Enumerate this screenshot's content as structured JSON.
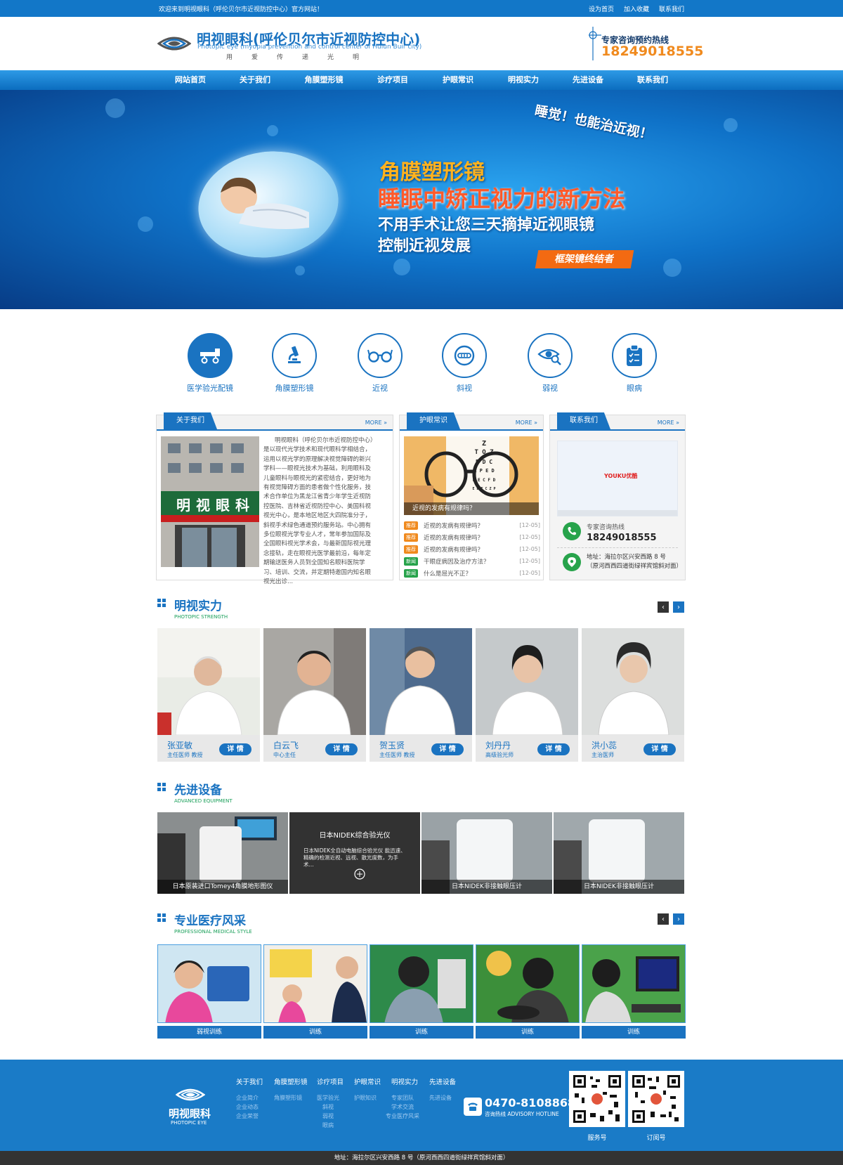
{
  "topbar": {
    "welcome": "欢迎来到明视眼科（呼伦贝尔市近视防控中心）官方网站！",
    "links": [
      "设为首页",
      "加入收藏",
      "联系我们"
    ]
  },
  "header": {
    "logo_title": "明视眼科(呼伦贝尔市近视防控中心)",
    "logo_en": "Photopic eye (myopia prevention and control center of Hulun Buir city)",
    "slogan": "用爱传递光明",
    "hotline_label": "专家咨询预约热线",
    "hotline_number": "18249018555"
  },
  "nav": [
    "网站首页",
    "关于我们",
    "角膜塑形镜",
    "诊疗项目",
    "护眼常识",
    "明视实力",
    "先进设备",
    "联系我们"
  ],
  "banner": {
    "tagline": "睡觉！也能治近视！",
    "h1": "角膜塑形镜",
    "h2": "睡眠中矫正视力的新方法",
    "h3": "不用手术让您三天摘掉近视眼镜",
    "h4": "控制近视发展",
    "tag": "框架镜终结者"
  },
  "services": [
    {
      "label": "医学验光配镜",
      "icon": "glasses-fitting-icon"
    },
    {
      "label": "角膜塑形镜",
      "icon": "microscope-icon"
    },
    {
      "label": "近视",
      "icon": "eyeglasses-icon"
    },
    {
      "label": "斜视",
      "icon": "strabismus-icon"
    },
    {
      "label": "弱视",
      "icon": "eye-search-icon"
    },
    {
      "label": "眼病",
      "icon": "clipboard-icon"
    }
  ],
  "about": {
    "tab": "关于我们",
    "more": "MORE",
    "sign_text": "明视眼科",
    "text": "明视眼科（呼伦贝尔市近视防控中心）是以现代光学技术和现代眼科学相结合，运用以视光学的原理解决视觉障碍的新兴学科——眼视光技术为基础，利用眼科及儿童眼科与眼视光的紧密结合，更好地为有视觉障碍方面的患者做个性化服务，技术合作单位为黑龙江省青少年学生近视防控医院、吉林省近视防控中心、美国科视视光中心，是本地区地区大四院准分子，斜视手术绿色通道预约服务站。中心拥有多位眼视光学专业人才，常年参加国际及全国眼科视光学术会，与最新国际视光理念接轨，走在眼视光医学最前沿，每年定期输送医务人员到全国知名眼科医院学习、培训、交流，并定期特邀国内知名眼视光出诊..."
  },
  "news": {
    "tab": "护眼常识",
    "more": "MORE",
    "caption": "近视的发病有规律吗？",
    "chart_lines": [
      "Z",
      "T O Z",
      "P D C",
      "L P E D",
      "P E C F D",
      "E D F C Z P"
    ],
    "items": [
      {
        "badge": "推荐",
        "color": "#f08a1e",
        "title": "近视的发病有规律吗？",
        "date": "[12-05]"
      },
      {
        "badge": "推荐",
        "color": "#f08a1e",
        "title": "近视的发病有规律吗？",
        "date": "[12-05]"
      },
      {
        "badge": "推荐",
        "color": "#f08a1e",
        "title": "近视的发病有规律吗？",
        "date": "[12-05]"
      },
      {
        "badge": "新闻",
        "color": "#27a34b",
        "title": "干眼症病因及治疗方法？",
        "date": "[12-05]"
      },
      {
        "badge": "新闻",
        "color": "#27a34b",
        "title": "什么是屈光不正？",
        "date": "[12-05]"
      }
    ]
  },
  "contact": {
    "tab": "联系我们",
    "more": "MORE",
    "video_brand": "YOUKU优酷",
    "hotline_label": "专家咨询热线",
    "hotline": "18249018555",
    "address_label": "地址：海拉尔区兴安西路 8 号",
    "address_note": "（原河西西四道街绿祥宾馆斜对面）"
  },
  "strength": {
    "title": "明视实力",
    "subtitle": "PHOTOPIC STRENGTH",
    "detail_label": "详 情",
    "doctors": [
      {
        "name": "张亚敏",
        "title": "主任医师 教授"
      },
      {
        "name": "白云飞",
        "title": "中心主任"
      },
      {
        "name": "贺玉贤",
        "title": "主任医师 教授"
      },
      {
        "name": "刘丹丹",
        "title": "高级验光师"
      },
      {
        "name": "洪小蕊",
        "title": "主治医师"
      }
    ]
  },
  "equipment": {
    "title": "先进设备",
    "subtitle": "ADVANCED EQUIPMENT",
    "overlay_title": "日本NIDEK综合验光仪",
    "overlay_text": "日本NIDEK全自动电脑综合验光仪 能迅速、精确的检测近视、远视、散光度数，为手术...",
    "items": [
      "日本原装进口Tomey4角膜地形图仪",
      "日本NIDEK综合验光仪",
      "日本NIDEK非接触眼压计",
      "日本NIDEK非接触眼压计"
    ]
  },
  "style": {
    "title": "专业医疗风采",
    "subtitle": "PROFESSIONAL MEDICAL STYLE",
    "items": [
      "弱视训练",
      "训练",
      "训练",
      "训练",
      "训练"
    ]
  },
  "footer": {
    "logo_cn": "明视眼科",
    "logo_en": "PHOTOPIC EYE",
    "cols": [
      {
        "h": "关于我们",
        "s": [
          "企业简介",
          "企业动态",
          "企业荣誉"
        ]
      },
      {
        "h": "角膜塑形镜",
        "s": [
          "角膜塑形镜"
        ]
      },
      {
        "h": "诊疗项目",
        "s": [
          "医学验光",
          "斜视",
          "弱视",
          "眼病"
        ]
      },
      {
        "h": "护眼常识",
        "s": [
          "护眼知识"
        ]
      },
      {
        "h": "明视实力",
        "s": [
          "专家团队",
          "学术交流",
          "专业医疗风采"
        ]
      },
      {
        "h": "先进设备",
        "s": [
          "先进设备"
        ]
      }
    ],
    "phone": "0470-8108868",
    "phone_label": "咨询热线 ADVISORY HOTLINE",
    "qr1": "服务号",
    "qr2": "订阅号"
  },
  "bottom": "地址：海拉尔区兴安西路 8 号（原河西西四道街绿祥宾馆斜对面）",
  "colors": {
    "primary": "#1a73c1",
    "accent": "#f08a1e",
    "green": "#27a34b",
    "footer": "#1a7bc7"
  }
}
